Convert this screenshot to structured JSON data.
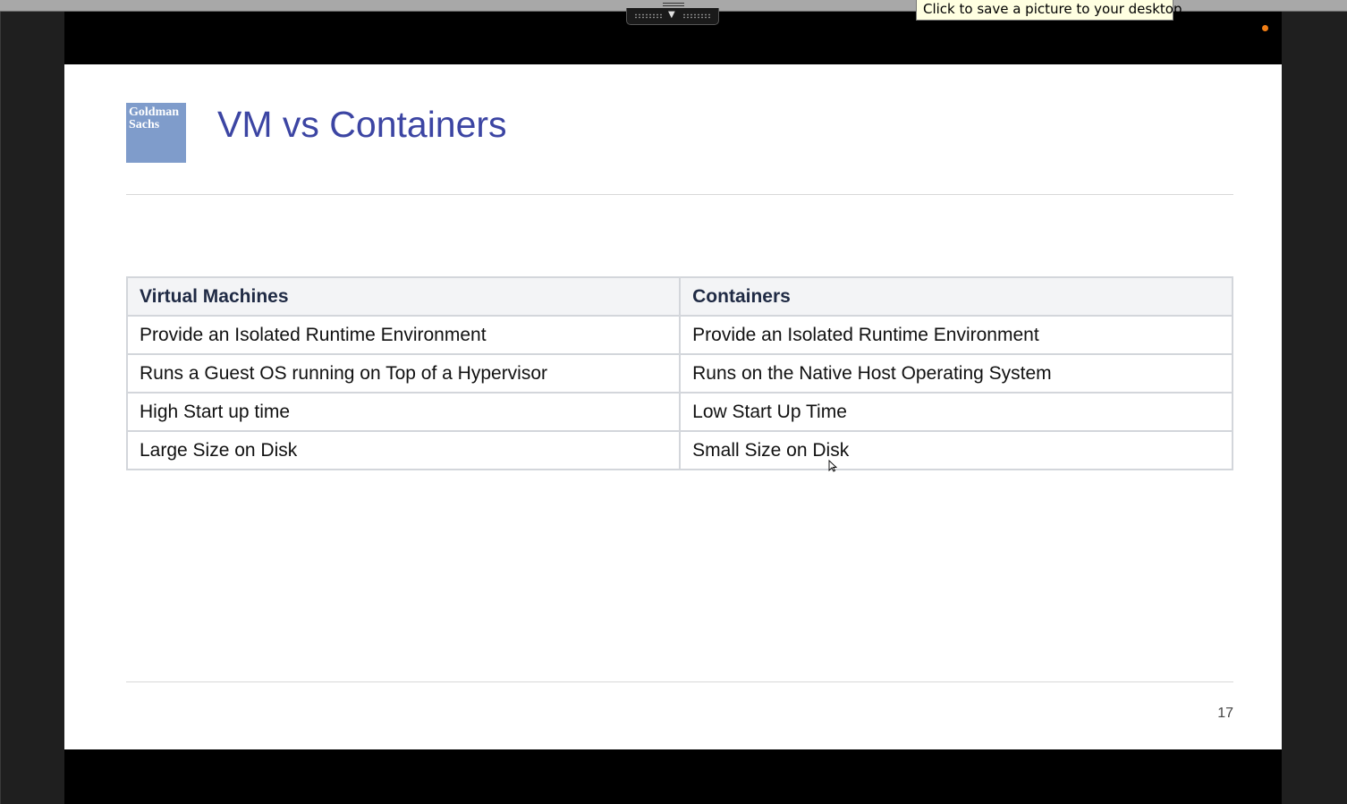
{
  "tooltip": {
    "text": "Click to save a picture to your desktop."
  },
  "slide": {
    "logo": {
      "line1": "Goldman",
      "line2": "Sachs"
    },
    "title": "VM vs Containers",
    "table": {
      "headers": [
        "Virtual Machines",
        "Containers"
      ],
      "rows": [
        [
          "Provide an Isolated Runtime Environment",
          "Provide an Isolated Runtime Environment"
        ],
        [
          "Runs a Guest OS running on Top of a Hypervisor",
          "Runs on the Native Host Operating System"
        ],
        [
          "High Start up time",
          "Low Start Up Time"
        ],
        [
          "Large Size on Disk",
          "Small Size on Disk"
        ]
      ]
    },
    "page_number": "17"
  },
  "colors": {
    "title": "#3c45a3",
    "logo_bg": "#7f9ccb",
    "header_bg": "#f3f4f6",
    "recording_dot": "#f07d15",
    "tooltip_bg": "#ffffe1"
  },
  "icons": {
    "handle_arrow": "arrow-down-icon",
    "recording": "recording-dot-icon",
    "cursor": "mouse-cursor-icon"
  }
}
